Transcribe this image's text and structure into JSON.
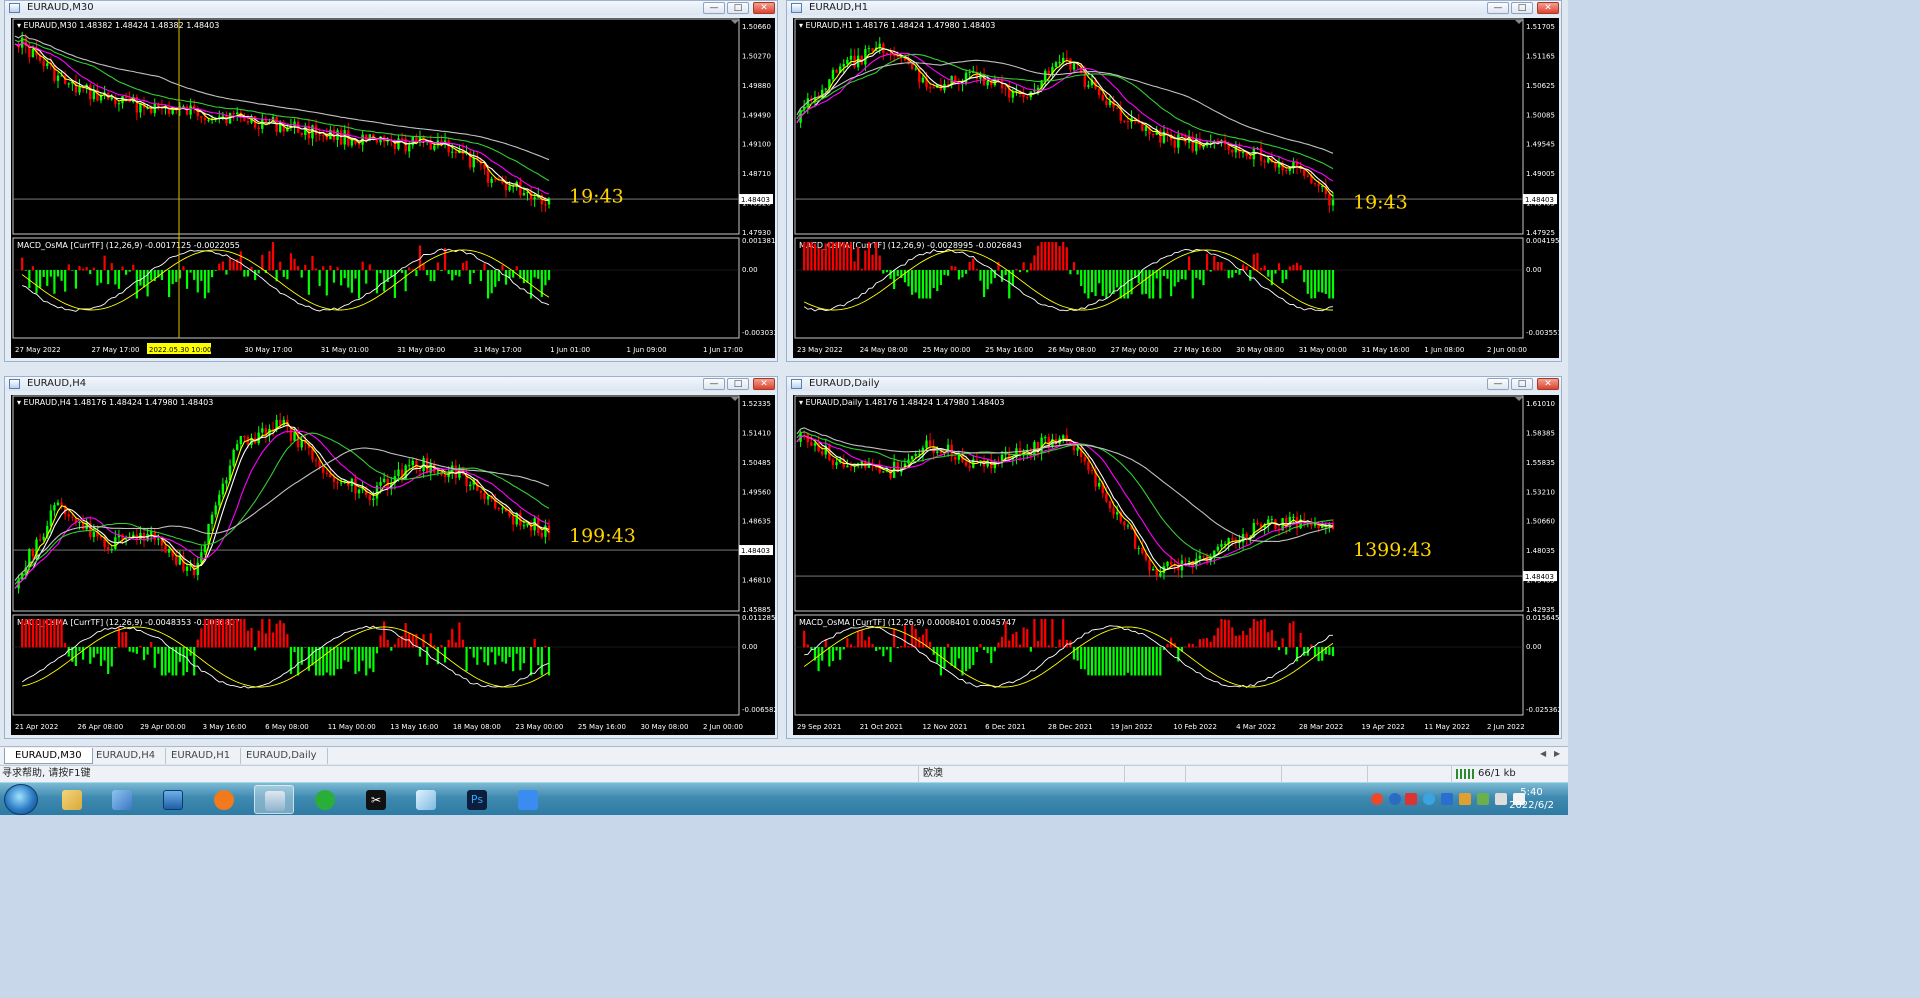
{
  "windows": [
    {
      "id": "m30",
      "title": "EURAUD,M30",
      "header_line": "EURAUD,M30  1.48382 1.48424 1.48382 1.48403",
      "macd_label": "MACD_OsMA [CurrTF] (12,26,9) -0.0017125 -0.0022055",
      "price_ticks": [
        "1.50660",
        "1.50270",
        "1.49880",
        "1.49490",
        "1.49100",
        "1.48710",
        "1.48320",
        "1.47930"
      ],
      "macd_ticks": [
        "0.001381",
        "0.00",
        "-0.003033"
      ],
      "current_price": "1.48403",
      "timer": "19:43",
      "time_labels": [
        "27 May 2022",
        "27 May 17:00",
        "30 May",
        "30 May 17:00",
        "31 May 01:00",
        "31 May 09:00",
        "31 May 17:00",
        "1 Jun 01:00",
        "1 Jun 09:00",
        "1 Jun 17:00"
      ],
      "crosshair_label": "2022.05.30 10:00"
    },
    {
      "id": "h1",
      "title": "EURAUD,H1",
      "header_line": "EURAUD,H1  1.48176 1.48424 1.47980 1.48403",
      "macd_label": "MACD_OsMA [CurrTF] (12,26,9) -0.0028995 -0.0026843",
      "price_ticks": [
        "1.51705",
        "1.51165",
        "1.50625",
        "1.50085",
        "1.49545",
        "1.49005",
        "1.48465",
        "1.47925"
      ],
      "macd_ticks": [
        "0.0041955",
        "0.00",
        "-0.003551"
      ],
      "current_price": "1.48403",
      "timer": "19:43",
      "time_labels": [
        "23 May 2022",
        "24 May 08:00",
        "25 May 00:00",
        "25 May 16:00",
        "26 May 08:00",
        "27 May 00:00",
        "27 May 16:00",
        "30 May 08:00",
        "31 May 00:00",
        "31 May 16:00",
        "1 Jun 08:00",
        "2 Jun 00:00"
      ]
    },
    {
      "id": "h4",
      "title": "EURAUD,H4",
      "header_line": "EURAUD,H4  1.48176 1.48424 1.47980 1.48403",
      "macd_label": "MACD_OsMA [CurrTF] (12,26,9) -0.0048353 -0.0036807",
      "price_ticks": [
        "1.52335",
        "1.51410",
        "1.50485",
        "1.49560",
        "1.48635",
        "1.47710",
        "1.46810",
        "1.45885"
      ],
      "macd_ticks": [
        "0.0112857",
        "0.00",
        "-0.006582"
      ],
      "current_price": "1.48403",
      "timer": "199:43",
      "time_labels": [
        "21 Apr 2022",
        "26 Apr 08:00",
        "29 Apr 00:00",
        "3 May 16:00",
        "6 May 08:00",
        "11 May 00:00",
        "13 May 16:00",
        "18 May 08:00",
        "23 May 00:00",
        "25 May 16:00",
        "30 May 08:00",
        "2 Jun 00:00"
      ]
    },
    {
      "id": "d1",
      "title": "EURAUD,Daily",
      "header_line": "EURAUD,Daily  1.48176 1.48424 1.47980 1.48403",
      "macd_label": "MACD_OsMA [CurrTF] (12,26,9) 0.0008401 0.0045747",
      "price_ticks": [
        "1.61010",
        "1.58385",
        "1.55835",
        "1.53210",
        "1.50660",
        "1.48035",
        "1.45485",
        "1.42935"
      ],
      "macd_ticks": [
        "0.015645",
        "0.00",
        "-0.025362"
      ],
      "current_price": "1.48403",
      "timer": "1399:43",
      "time_labels": [
        "29 Sep 2021",
        "21 Oct 2021",
        "12 Nov 2021",
        "6 Dec 2021",
        "28 Dec 2021",
        "19 Jan 2022",
        "10 Feb 2022",
        "4 Mar 2022",
        "28 Mar 2022",
        "19 Apr 2022",
        "11 May 2022",
        "2 Jun 2022"
      ]
    }
  ],
  "tabs": [
    "EURAUD,M30",
    "EURAUD,H4",
    "EURAUD,H1",
    "EURAUD,Daily"
  ],
  "status": {
    "help": "寻求帮助, 请按F1键",
    "profile": "欧澳",
    "traffic": "66/1 kb"
  },
  "ime": [
    "中",
    "°,"
  ],
  "clock": {
    "time": "5:40",
    "date": "2022/6/2"
  },
  "colors": {
    "bull": "#00ff00",
    "bear": "#ff0000",
    "ma_fast": "#ffff00",
    "ma_white": "#ffffff",
    "ma_magenta": "#ff00ff",
    "ma_green": "#32cd32",
    "ma_gray": "#c0c0c0",
    "timer": "#ffd400"
  }
}
